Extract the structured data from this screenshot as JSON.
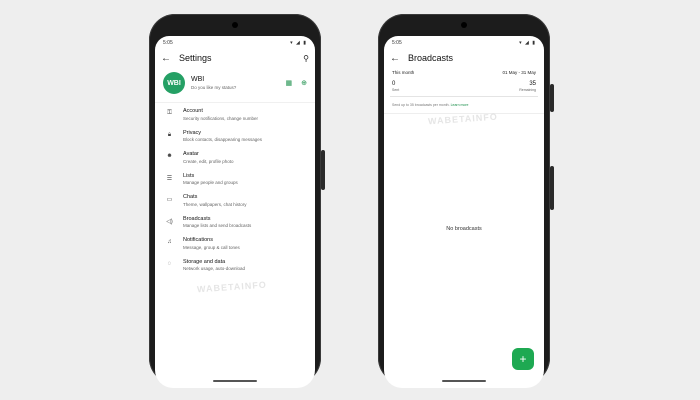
{
  "settings_screen": {
    "status_time": "5:05",
    "status_icons": "▾ ◢ ▮",
    "title": "Settings",
    "profile": {
      "initials": "WBI",
      "name": "WBI",
      "status": "Do you like my status?"
    },
    "items": [
      {
        "icon": "key-icon",
        "label": "Account",
        "sub": "Security notifications, change number"
      },
      {
        "icon": "lock-icon",
        "label": "Privacy",
        "sub": "Block contacts, disappearing messages"
      },
      {
        "icon": "avatar-icon",
        "label": "Avatar",
        "sub": "Create, edit, profile photo"
      },
      {
        "icon": "lists-icon",
        "label": "Lists",
        "sub": "Manage people and groups"
      },
      {
        "icon": "chat-icon",
        "label": "Chats",
        "sub": "Theme, wallpapers, chat history"
      },
      {
        "icon": "broadcast-icon",
        "label": "Broadcasts",
        "sub": "Manage lists and send broadcasts"
      },
      {
        "icon": "bell-icon",
        "label": "Notifications",
        "sub": "Message, group & call tones"
      },
      {
        "icon": "storage-icon",
        "label": "Storage and data",
        "sub": "Network usage, auto-download"
      }
    ]
  },
  "broadcasts_screen": {
    "status_time": "5:05",
    "status_icons": "▾ ◢ ▮",
    "title": "Broadcasts",
    "period_label": "This month",
    "period_range": "01 May - 31 May",
    "sent_count": "0",
    "sent_label": "Sent",
    "remaining_count": "35",
    "remaining_label": "Remaining",
    "note": "Send up to 35 broadcasts per month.",
    "note_link": "Learn more",
    "empty_text": "No broadcasts",
    "fab_symbol": "+"
  },
  "watermark": "WABETAINFO",
  "colors": {
    "accent": "#1ea952",
    "avatar_bg": "#25a065",
    "background": "#eeeeee"
  }
}
